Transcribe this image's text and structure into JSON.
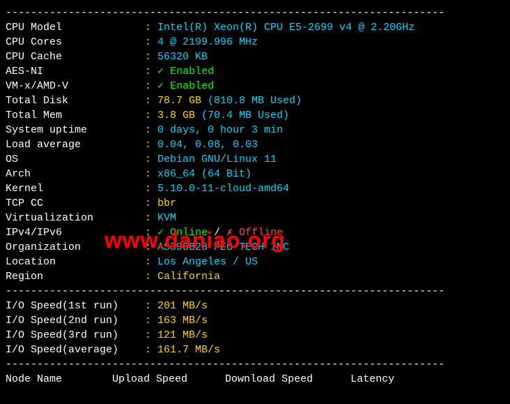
{
  "divider": "----------------------------------------------------------------------",
  "info": {
    "cpu_model_label": "CPU Model          ",
    "cpu_model": "Intel(R) Xeon(R) CPU E5-2699 v4 @ 2.20GHz",
    "cpu_cores_label": "CPU Cores          ",
    "cpu_cores": "4 @ 2199.996 MHz",
    "cpu_cache_label": "CPU Cache          ",
    "cpu_cache": "56320 KB",
    "aes_label": "AES-NI             ",
    "aes_check": "✓ ",
    "aes_val": "Enabled",
    "vmx_label": "VM-x/AMD-V         ",
    "vmx_check": "✓ ",
    "vmx_val": "Enabled",
    "disk_label": "Total Disk         ",
    "disk_size": "78.7 GB ",
    "disk_used": "(810.8 MB Used)",
    "mem_label": "Total Mem          ",
    "mem_size": "3.8 GB ",
    "mem_used": "(70.4 MB Used)",
    "uptime_label": "System uptime      ",
    "uptime": "0 days, 0 hour 3 min",
    "load_label": "Load average       ",
    "load": "0.04, 0.08, 0.03",
    "os_label": "OS                 ",
    "os": "Debian GNU/Linux 11",
    "arch_label": "Arch               ",
    "arch": "x86_64 (64 Bit)",
    "kernel_label": "Kernel             ",
    "kernel": "5.10.0-11-cloud-amd64",
    "tcpcc_label": "TCP CC             ",
    "tcpcc": "bbr",
    "virt_label": "Virtualization     ",
    "virt": "KVM",
    "ip_label": "IPv4/IPv6          ",
    "ip_online_check": "✓ ",
    "ip_online": "Online",
    "ip_sep": " / ",
    "ip_offline_cross": "✗ ",
    "ip_offline": "Offline",
    "org_label": "Organization       ",
    "org": "AS398823 PEG TECH INC",
    "loc_label": "Location           ",
    "loc": "Los Angeles / US",
    "region_label": "Region             ",
    "region": "California"
  },
  "io": {
    "run1_label": "I/O Speed(1st run) ",
    "run1": "201 MB/s",
    "run2_label": "I/O Speed(2nd run) ",
    "run2": "163 MB/s",
    "run3_label": "I/O Speed(3rd run) ",
    "run3": "121 MB/s",
    "avg_label": "I/O Speed(average) ",
    "avg": "161.7 MB/s"
  },
  "headers": "Node Name        Upload Speed      Download Speed      Latency     ",
  "watermark": "www.daniao.org",
  "colon": ": "
}
